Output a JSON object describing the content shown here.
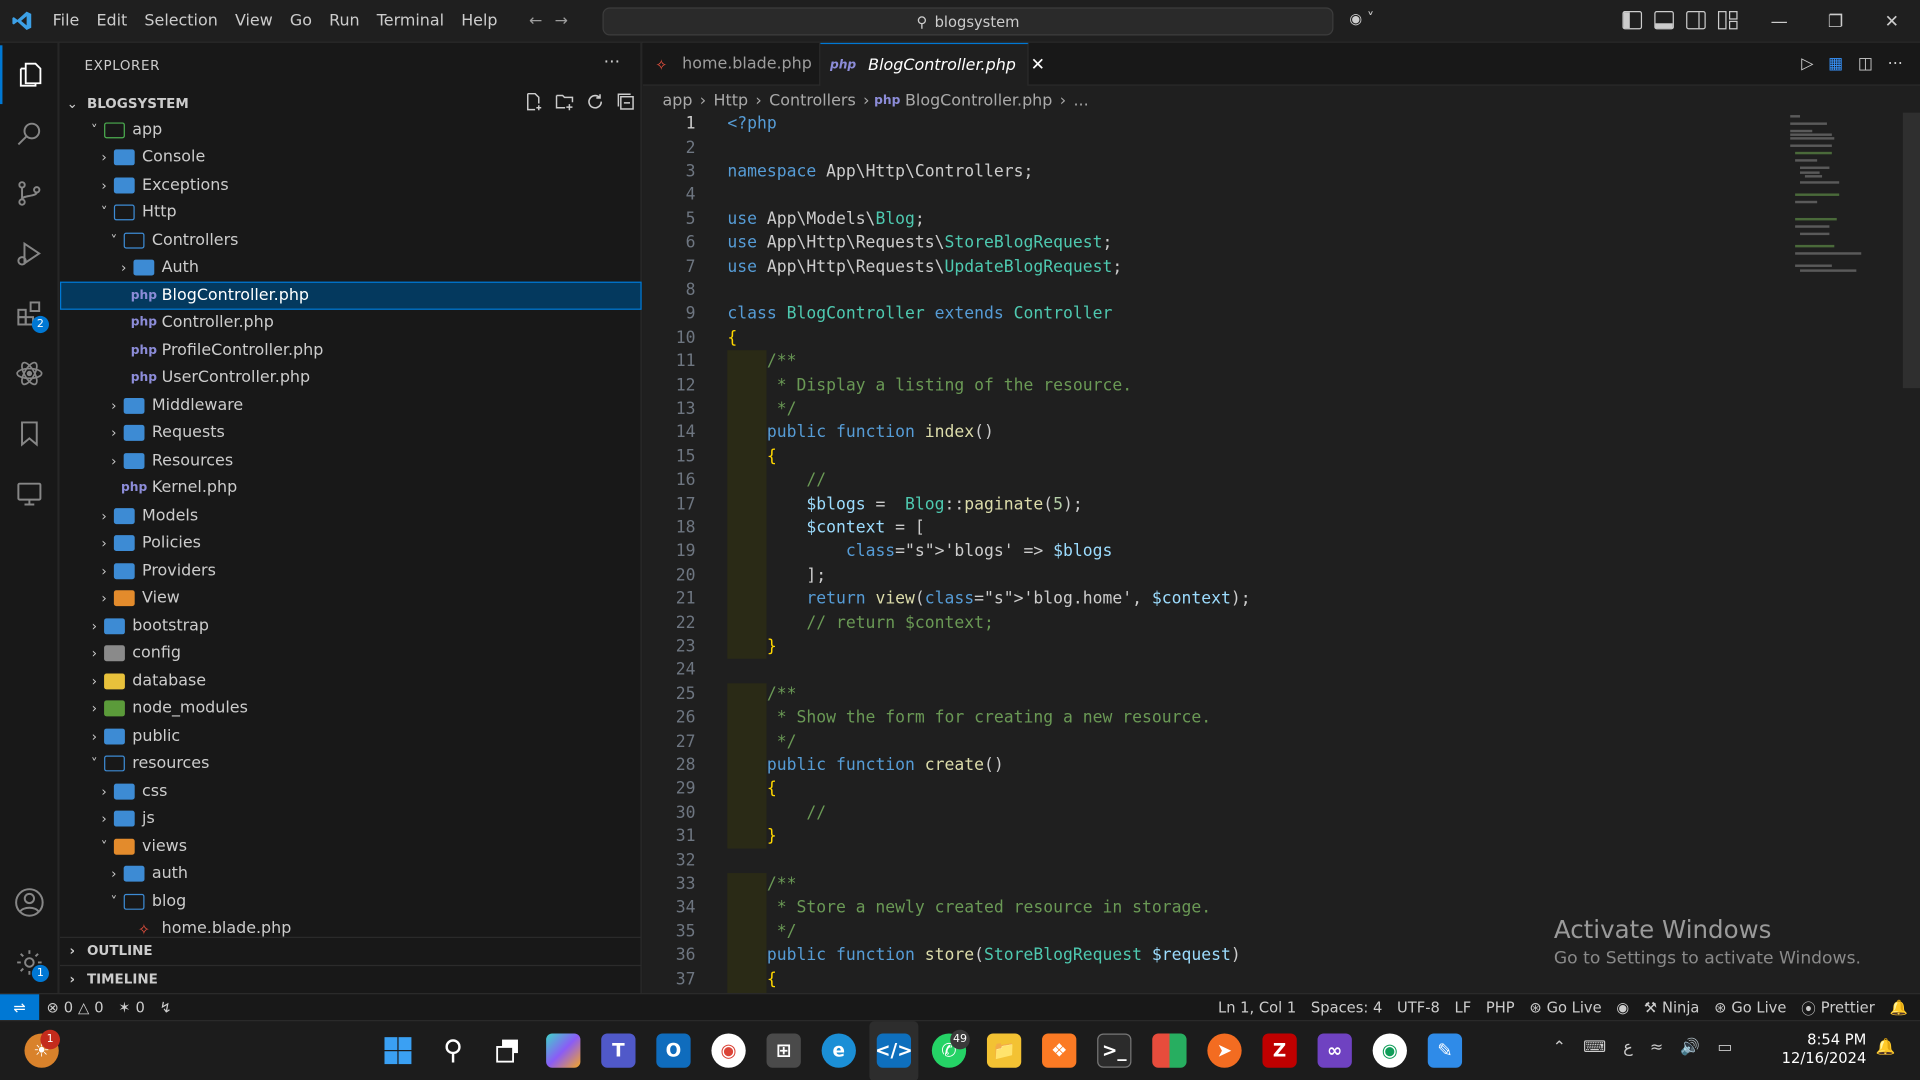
{
  "window": {
    "search_text": "blogsystem"
  },
  "menu": [
    "File",
    "Edit",
    "Selection",
    "View",
    "Go",
    "Run",
    "Terminal",
    "Help"
  ],
  "activity_badges": {
    "extensions": "2",
    "settings": "1"
  },
  "sidebar": {
    "title": "EXPLORER",
    "project": "BLOGSYSTEM",
    "tree": [
      {
        "label": "app",
        "depth": 1,
        "kind": "folder-open-special"
      },
      {
        "label": "Console",
        "depth": 2,
        "kind": "folder"
      },
      {
        "label": "Exceptions",
        "depth": 2,
        "kind": "folder"
      },
      {
        "label": "Http",
        "depth": 2,
        "kind": "folder-open"
      },
      {
        "label": "Controllers",
        "depth": 3,
        "kind": "folder-open"
      },
      {
        "label": "Auth",
        "depth": 4,
        "kind": "folder"
      },
      {
        "label": "BlogController.php",
        "depth": 4,
        "kind": "php",
        "selected": true
      },
      {
        "label": "Controller.php",
        "depth": 4,
        "kind": "php"
      },
      {
        "label": "ProfileController.php",
        "depth": 4,
        "kind": "php"
      },
      {
        "label": "UserController.php",
        "depth": 4,
        "kind": "php"
      },
      {
        "label": "Middleware",
        "depth": 3,
        "kind": "folder"
      },
      {
        "label": "Requests",
        "depth": 3,
        "kind": "folder"
      },
      {
        "label": "Resources",
        "depth": 3,
        "kind": "folder"
      },
      {
        "label": "Kernel.php",
        "depth": 3,
        "kind": "php"
      },
      {
        "label": "Models",
        "depth": 2,
        "kind": "folder"
      },
      {
        "label": "Policies",
        "depth": 2,
        "kind": "folder"
      },
      {
        "label": "Providers",
        "depth": 2,
        "kind": "folder"
      },
      {
        "label": "View",
        "depth": 2,
        "kind": "folder-view"
      },
      {
        "label": "bootstrap",
        "depth": 1,
        "kind": "folder"
      },
      {
        "label": "config",
        "depth": 1,
        "kind": "folder-config"
      },
      {
        "label": "database",
        "depth": 1,
        "kind": "folder-db"
      },
      {
        "label": "node_modules",
        "depth": 1,
        "kind": "folder-node"
      },
      {
        "label": "public",
        "depth": 1,
        "kind": "folder"
      },
      {
        "label": "resources",
        "depth": 1,
        "kind": "folder-open"
      },
      {
        "label": "css",
        "depth": 2,
        "kind": "folder"
      },
      {
        "label": "js",
        "depth": 2,
        "kind": "folder"
      },
      {
        "label": "views",
        "depth": 2,
        "kind": "folder-view-open"
      },
      {
        "label": "auth",
        "depth": 3,
        "kind": "folder"
      },
      {
        "label": "blog",
        "depth": 3,
        "kind": "folder-open"
      },
      {
        "label": "home.blade.php",
        "depth": 4,
        "kind": "blade"
      }
    ],
    "outline": "OUTLINE",
    "timeline": "TIMELINE"
  },
  "tabs": [
    {
      "label": "home.blade.php",
      "active": false
    },
    {
      "label": "BlogController.php",
      "active": true
    }
  ],
  "breadcrumb": [
    "app",
    "Http",
    "Controllers",
    "BlogController.php",
    "..."
  ],
  "code_lines": [
    "<?php",
    "",
    "namespace App\\Http\\Controllers;",
    "",
    "use App\\Models\\Blog;",
    "use App\\Http\\Requests\\StoreBlogRequest;",
    "use App\\Http\\Requests\\UpdateBlogRequest;",
    "",
    "class BlogController extends Controller",
    "{",
    "    /**",
    "     * Display a listing of the resource.",
    "     */",
    "    public function index()",
    "    {",
    "        //",
    "        $blogs =  Blog::paginate(5);",
    "        $context = [",
    "            'blogs' => $blogs",
    "        ];",
    "        return view('blog.home', $context);",
    "        // return $context;",
    "    }",
    "",
    "    /**",
    "     * Show the form for creating a new resource.",
    "     */",
    "    public function create()",
    "    {",
    "        //",
    "    }",
    "",
    "    /**",
    "     * Store a newly created resource in storage.",
    "     */",
    "    public function store(StoreBlogRequest $request)",
    "    {"
  ],
  "watermark": {
    "title": "Activate Windows",
    "subtitle": "Go to Settings to activate Windows."
  },
  "status": {
    "errors": "0",
    "warnings": "0",
    "ports": "0",
    "position": "Ln 1, Col 1",
    "spaces": "Spaces: 4",
    "encoding": "UTF-8",
    "eol": "LF",
    "language": "PHP",
    "golive1": "Go Live",
    "ninja": "Ninja",
    "golive2": "Go Live",
    "prettier": "Prettier"
  },
  "taskbar": {
    "time": "8:54 PM",
    "date": "12/16/2024",
    "whatsapp_badge": "49",
    "weather_badge": "1"
  }
}
